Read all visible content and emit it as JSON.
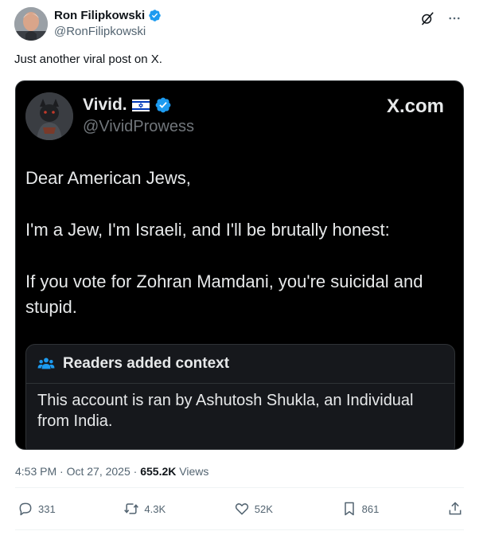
{
  "author": {
    "name": "Ron Filipkowski",
    "handle": "@RonFilipkowski"
  },
  "post": {
    "text": "Just another viral post on X."
  },
  "embedded": {
    "name": "Vivid.",
    "handle": "@VividProwess",
    "site": "X.com",
    "body": [
      "Dear American Jews,",
      "I'm a Jew, I'm Israeli, and I'll be brutally honest:",
      "If you vote for Zohran Mamdani, you're suicidal and stupid."
    ],
    "context_title": "Readers added context",
    "context_text": "This account is ran by Ashutosh Shukla, an Individual from India."
  },
  "meta": {
    "time": "4:53 PM",
    "separator": "·",
    "date": "Oct 27, 2025",
    "views_count": "655.2K",
    "views_label": "Views"
  },
  "actions": {
    "replies": "331",
    "reposts": "4.3K",
    "likes": "52K",
    "bookmarks": "861"
  },
  "icons": [
    "verified-badge-icon",
    "grok-icon",
    "more-icon",
    "israel-flag-icon",
    "community-icon",
    "reply-icon",
    "repost-icon",
    "like-icon",
    "bookmark-icon",
    "share-icon"
  ],
  "colors": {
    "verified": "#1d9bf0",
    "muted": "#536471",
    "card_bg": "#000000"
  }
}
